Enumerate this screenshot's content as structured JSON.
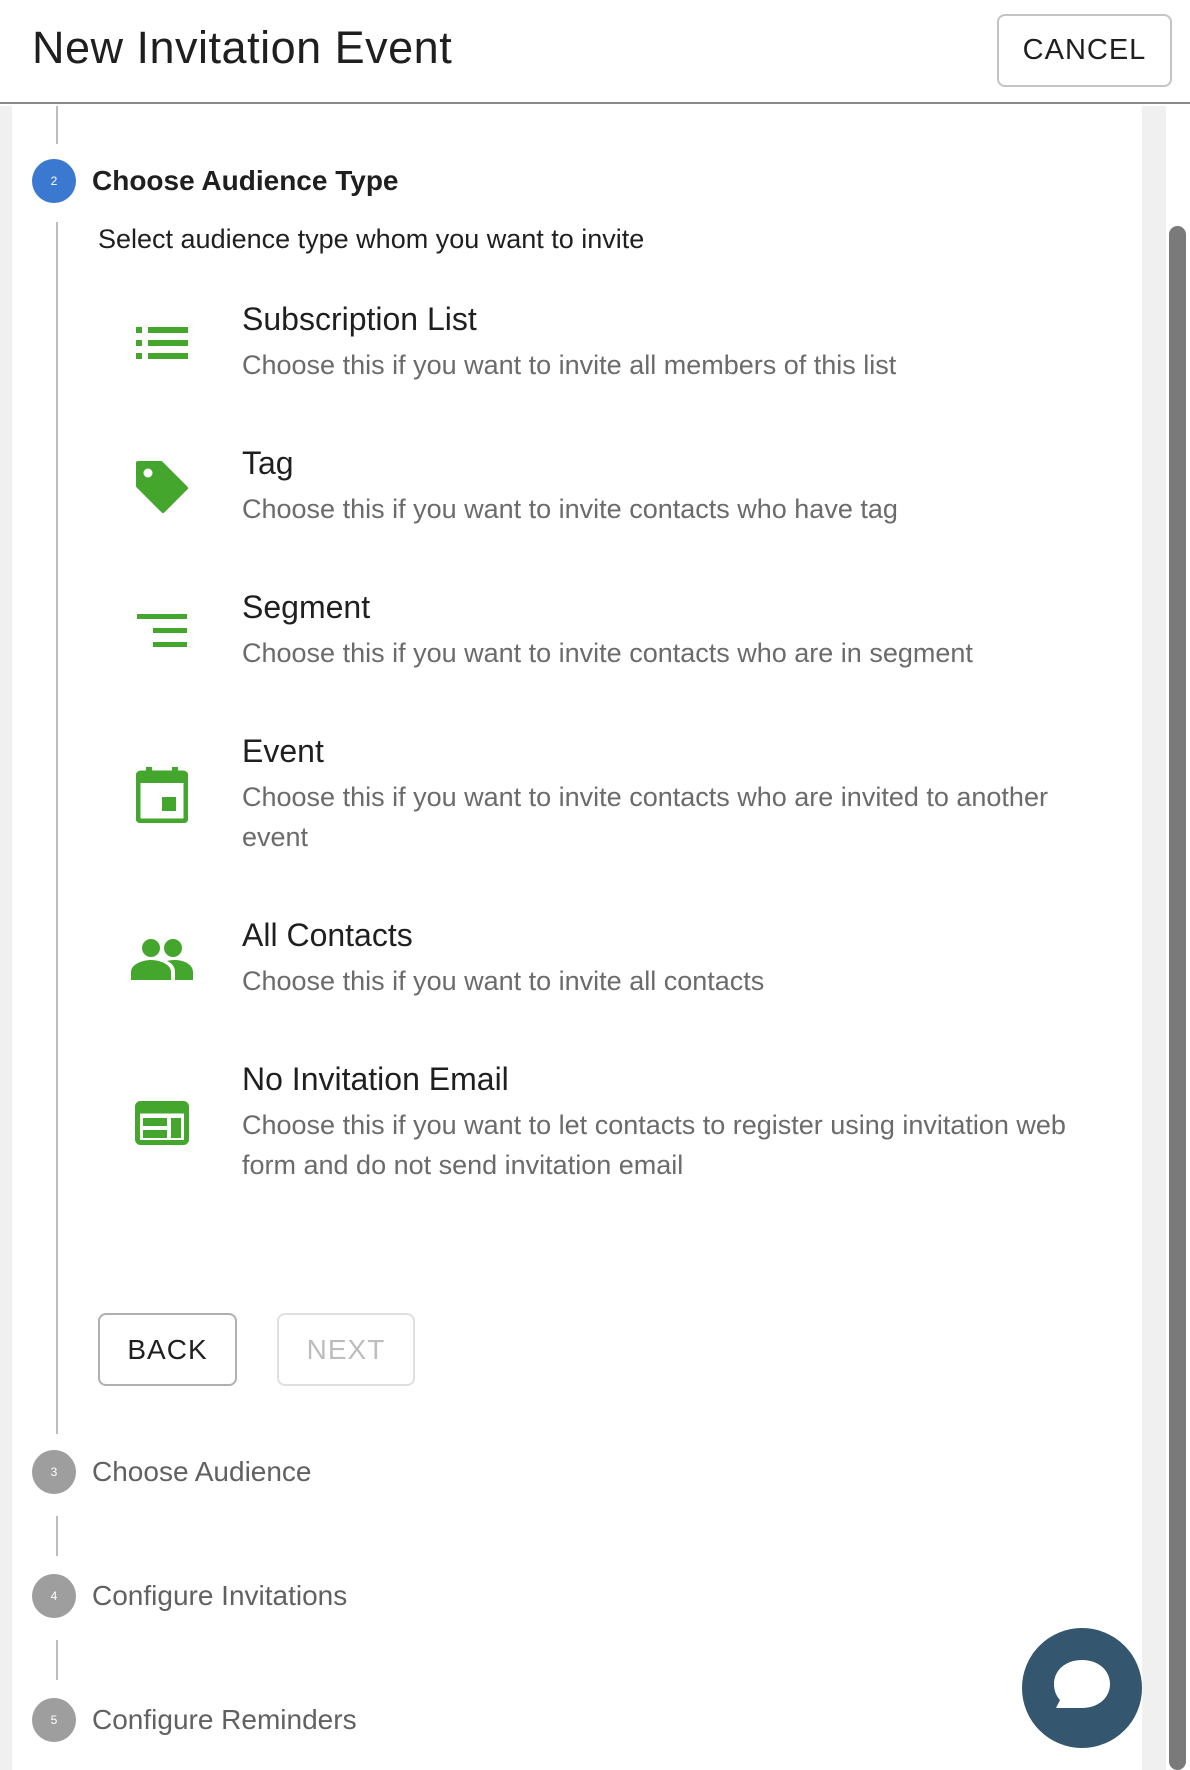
{
  "header": {
    "title": "New Invitation Event",
    "cancel_label": "CANCEL"
  },
  "steps": [
    {
      "number": "2",
      "label": "Choose Audience Type",
      "state": "active"
    },
    {
      "number": "3",
      "label": "Choose Audience",
      "state": "inactive"
    },
    {
      "number": "4",
      "label": "Configure Invitations",
      "state": "inactive"
    },
    {
      "number": "5",
      "label": "Configure Reminders",
      "state": "inactive"
    }
  ],
  "audience": {
    "intro": "Select audience type whom you want to invite",
    "options": [
      {
        "icon": "list-icon",
        "title": "Subscription List",
        "description": "Choose this if you want to invite all members of this list"
      },
      {
        "icon": "tag-icon",
        "title": "Tag",
        "description": "Choose this if you want to invite contacts who have tag"
      },
      {
        "icon": "segment-icon",
        "title": "Segment",
        "description": "Choose this if you want to invite contacts who are in segment"
      },
      {
        "icon": "calendar-icon",
        "title": "Event",
        "description": "Choose this if you want to invite contacts who are invited to another event"
      },
      {
        "icon": "people-icon",
        "title": "All Contacts",
        "description": "Choose this if you want to invite all contacts"
      },
      {
        "icon": "web-form-icon",
        "title": "No Invitation Email",
        "description": "Choose this if you want to let contacts to register using invitation web form and do not send invitation email"
      }
    ]
  },
  "buttons": {
    "back_label": "BACK",
    "next_label": "NEXT"
  },
  "colors": {
    "icon_green": "#45a62e",
    "step_active": "#3b78d0",
    "step_inactive": "#9e9e9e",
    "chat_bubble": "#34566e"
  },
  "chat": {
    "icon": "chat-bubble-icon"
  }
}
